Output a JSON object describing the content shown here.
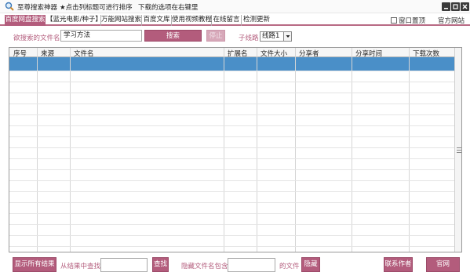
{
  "titlebar": {
    "app_name": "至尊搜索神器",
    "tip_sort": "★点击列标题可进行排序",
    "tip_download": "下载的选项在右键里"
  },
  "tabs": [
    {
      "label": "百度网盘搜索",
      "active": true
    },
    {
      "label": "【蓝光电影/种子】",
      "active": false
    },
    {
      "label": "万能网站搜索",
      "active": false
    },
    {
      "label": "百度文库",
      "active": false
    },
    {
      "label": "使用视频教程",
      "active": false
    },
    {
      "label": "在线留言",
      "active": false
    },
    {
      "label": "检测更新",
      "active": false
    }
  ],
  "tabbar_right": {
    "pin_label": "窗口置顶",
    "pin_checked": false,
    "official_site": "官方网站"
  },
  "search": {
    "label": "欲搜索的文件名:",
    "value": "学习方法",
    "search_button": "搜索",
    "stop_button": "停止",
    "line_label": "子线路",
    "line_value": "线路1"
  },
  "table": {
    "columns": [
      "序号",
      "来源",
      "文件名",
      "扩展名",
      "文件大小",
      "分享者",
      "分享时间",
      "下载次数"
    ],
    "selected_row": 0
  },
  "bottom": {
    "show_all": "显示所有结果",
    "filter_label": "从结果中查找:",
    "filter_value": "",
    "find_button": "查找",
    "hide_label": "隐藏文件名包含:",
    "hide_value": "",
    "hide_suffix": "的文件",
    "hide_button": "隐藏",
    "contact_button": "联系作者",
    "official_button": "官网"
  },
  "colors": {
    "accent": "#b35c7c",
    "selection": "#4a8fc8"
  }
}
